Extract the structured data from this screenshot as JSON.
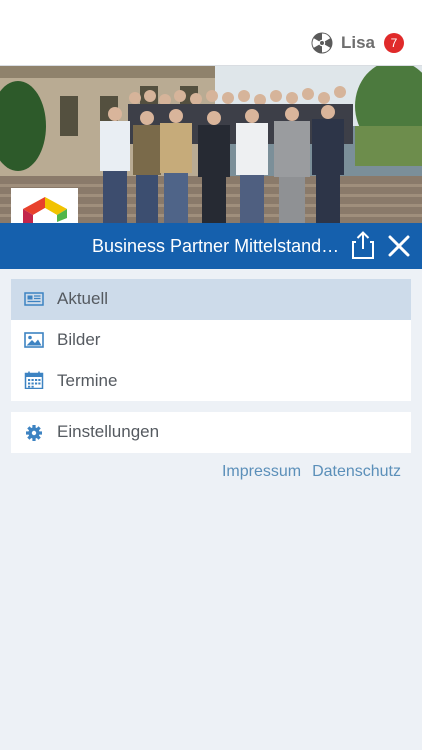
{
  "header": {
    "user_name": "Lisa",
    "notification_count": "7",
    "user_icon": "radiation-symbol-icon"
  },
  "hero": {
    "title": "Business Partner Mittelstands...",
    "share_icon": "share-icon",
    "close_icon": "close-icon",
    "title_bar_color": "#1560ad"
  },
  "menu": {
    "items": [
      {
        "label": "Aktuell",
        "icon": "newspaper-icon",
        "active": true
      },
      {
        "label": "Bilder",
        "icon": "image-icon",
        "active": false
      },
      {
        "label": "Termine",
        "icon": "calendar-icon",
        "active": false
      }
    ],
    "settings": {
      "label": "Einstellungen",
      "icon": "gear-icon"
    }
  },
  "footer": {
    "impressum": "Impressum",
    "datenschutz": "Datenschutz"
  },
  "colors": {
    "accent": "#1560ad",
    "active_item_bg": "#cddbea",
    "link": "#5b8fb9",
    "badge": "#e02a2a",
    "icon": "#3d83c2"
  }
}
